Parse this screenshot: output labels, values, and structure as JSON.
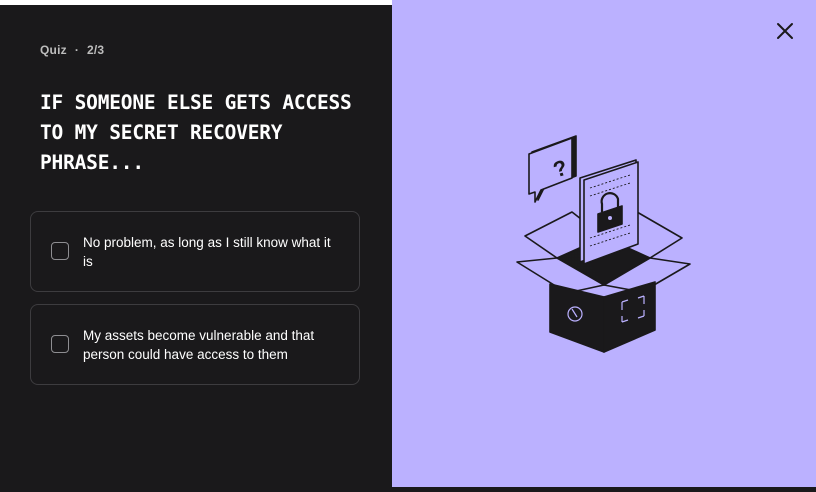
{
  "progress": {
    "fraction": 0.667
  },
  "quiz": {
    "label": "Quiz",
    "separator": "·",
    "step": "2/3"
  },
  "question": "IF SOMEONE ELSE GETS ACCESS TO MY SECRET RECOVERY PHRASE...",
  "options": [
    {
      "label": "No problem, as long as I still know what it is",
      "checked": false
    },
    {
      "label": "My assets become vulnerable and that person could have access to them",
      "checked": false
    }
  ],
  "illustration": {
    "icon": "open-box-with-locked-document-and-question-bubble",
    "mark": "?"
  },
  "colors": {
    "panel_left": "#1a191b",
    "panel_right": "#bbb1ff",
    "text": "#ffffff",
    "border": "#3d3c3f"
  },
  "close_icon": "close-icon"
}
